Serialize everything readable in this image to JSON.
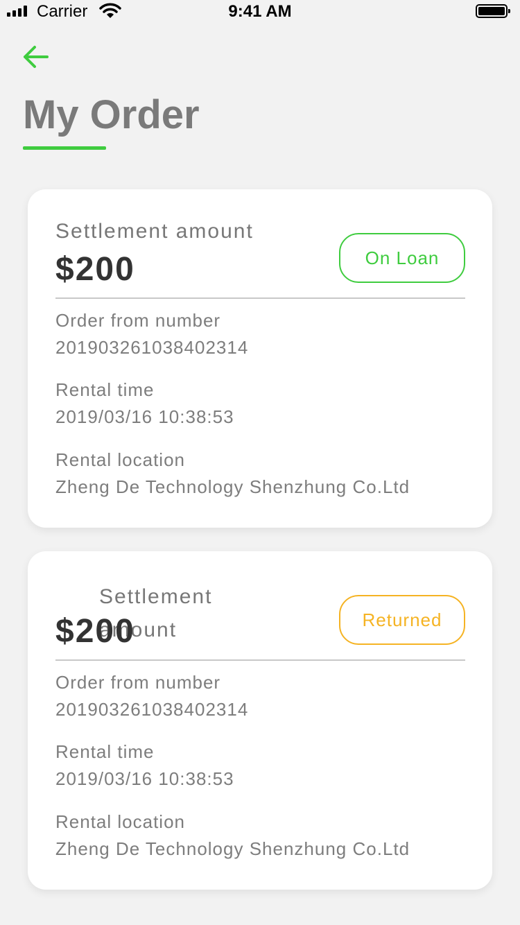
{
  "status_bar": {
    "carrier": "Carrier",
    "time": "9:41 AM"
  },
  "header": {
    "title": "My Order",
    "back_icon": "arrow-left-icon"
  },
  "colors": {
    "accent_green": "#3fcc3f",
    "returned_orange": "#f5b323",
    "background": "#f2f2f2"
  },
  "orders": [
    {
      "amount_label": "Settlement amount",
      "amount": "$200",
      "status": "On Loan",
      "status_color": "#3fcc3f",
      "order_number_label": "Order from number",
      "order_number": "201903261038402314",
      "rental_time_label": "Rental time",
      "rental_time": "2019/03/16 10:38:53",
      "rental_location_label": "Rental location",
      "rental_location": "Zheng De Technology Shenzhung Co.Ltd"
    },
    {
      "amount_label": "Settlement amount",
      "amount": "$200",
      "status": "Returned",
      "status_color": "#f5b323",
      "order_number_label": "Order from number",
      "order_number": "201903261038402314",
      "rental_time_label": "Rental time",
      "rental_time": "2019/03/16 10:38:53",
      "rental_location_label": "Rental location",
      "rental_location": "Zheng De Technology Shenzhung Co.Ltd"
    }
  ]
}
